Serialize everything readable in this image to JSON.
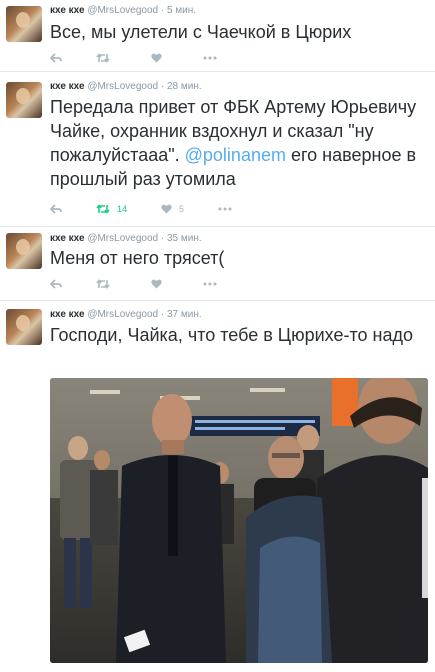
{
  "tweets": [
    {
      "name": "кхе кхе",
      "handle": "@MrsLovegood",
      "time": "· 5 мин.",
      "text": "Все, мы улетели с Чаечкой в Цюрих",
      "retweets": "",
      "likes": ""
    },
    {
      "name": "кхе кхе",
      "handle": "@MrsLovegood",
      "time": "· 28 мин.",
      "text_before": "Передала привет от ФБК Артему Юрьевичу Чайке, охранник вздохнул и сказал \"ну пожалуйстааа\". ",
      "mention": "@polinanem",
      "text_after": " его наверное в прошлый раз утомила",
      "retweets": "14",
      "likes": "5"
    },
    {
      "name": "кхе кхе",
      "handle": "@MrsLovegood",
      "time": "· 35 мин.",
      "text": "Меня от него трясет(",
      "retweets": "",
      "likes": ""
    },
    {
      "name": "кхе кхе",
      "handle": "@MrsLovegood",
      "time": "· 37 мин.",
      "text": "Господи, Чайка, что тебе в Цюрихе-то надо",
      "retweets": "",
      "likes": ""
    }
  ],
  "colors": {
    "link": "#55acee",
    "retweet_active": "#19cf86",
    "icon_idle": "#aab8c2",
    "meta": "#8899a6"
  },
  "icons": [
    "reply-icon",
    "retweet-icon",
    "like-icon",
    "more-icon"
  ]
}
